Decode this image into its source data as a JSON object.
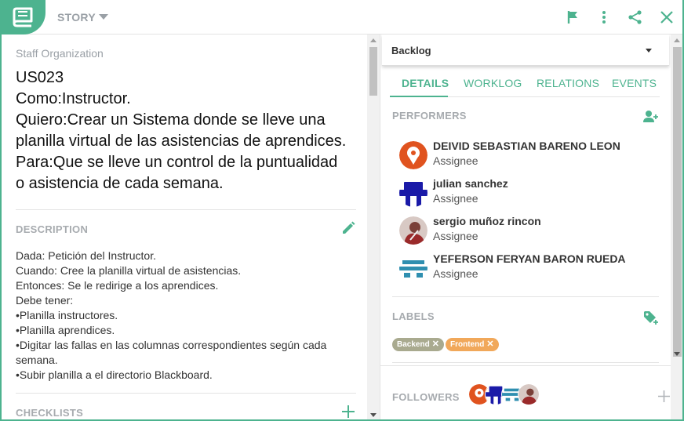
{
  "header": {
    "type_label": "STORY",
    "colors": {
      "accent": "#4db38f",
      "muted": "#9aa0a6"
    },
    "icons": [
      "book-icon",
      "flag-icon",
      "more-vert-icon",
      "share-icon",
      "close-icon"
    ]
  },
  "story": {
    "project": "Staff Organization",
    "title_lines": [
      "US023",
      "Como:Instructor.",
      "Quiero:Crear un Sistema donde se lleve una",
      "planilla virtual de las asistencias de aprendices.",
      "Para:Que se lleve un control de la puntualidad",
      "o asistencia de cada semana."
    ],
    "description_label": "DESCRIPTION",
    "description_lines": [
      "Dada: Petición del Instructor.",
      "Cuando: Cree la planilla virtual de asistencias.",
      "Entonces: Se le redirige a los aprendices.",
      "Debe tener:",
      "•Planilla instructores.",
      "•Planilla aprendices.",
      "•Digitar las fallas en las columnas correspondientes según cada",
      "semana.",
      "•Subir planilla a el directorio Blackboard."
    ],
    "checklists_label": "CHECKLISTS"
  },
  "status": {
    "value": "Backlog"
  },
  "tabs": [
    {
      "label": "DETAILS"
    },
    {
      "label": "WORKLOG"
    },
    {
      "label": "RELATIONS"
    },
    {
      "label": "EVENTS"
    }
  ],
  "performers": {
    "label": "PERFORMERS",
    "items": [
      {
        "name": "DEIVID SEBASTIAN BARENO LEON",
        "role": "Assignee",
        "avatar_color": "#e0531f"
      },
      {
        "name": "julian sanchez",
        "role": "Assignee",
        "avatar_color": "#1a1aa8"
      },
      {
        "name": "sergio muñoz rincon",
        "role": "Assignee",
        "avatar_color": "#8a3a3a"
      },
      {
        "name": "YEFERSON FERYAN BARON RUEDA",
        "role": "Assignee",
        "avatar_color": "#2f8fb0"
      }
    ]
  },
  "labels": {
    "label": "LABELS",
    "items": [
      {
        "text": "Backend",
        "color": "#a9aa8f"
      },
      {
        "text": "Frontend",
        "color": "#f1a85a"
      }
    ]
  },
  "followers": {
    "label": "FOLLOWERS"
  }
}
